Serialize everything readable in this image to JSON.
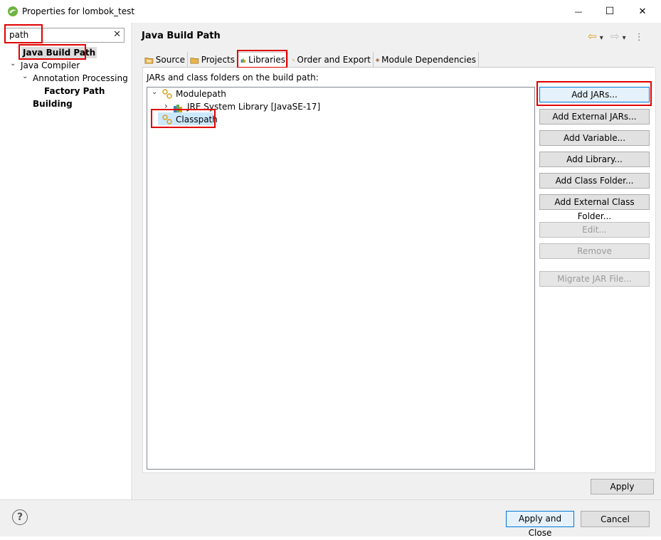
{
  "window": {
    "title": "Properties for lombok_test",
    "minimize_glyph": "—",
    "maximize_glyph": "☐",
    "close_glyph": "✕"
  },
  "filter": {
    "value": "path",
    "clear_glyph": "✕"
  },
  "nav_tree": {
    "items": [
      {
        "label": "Java Build Path",
        "arrow": ""
      },
      {
        "label": "Java Compiler",
        "arrow": "⌄"
      },
      {
        "label": "Annotation Processing",
        "arrow": "⌄"
      },
      {
        "label": "Factory Path",
        "arrow": ""
      },
      {
        "label": "Building",
        "arrow": ""
      }
    ]
  },
  "page": {
    "title": "Java Build Path",
    "back_glyph": "⇦",
    "dropdown_glyph": "▾",
    "forward_glyph": "⇨",
    "menu_glyph": "⋮"
  },
  "tabs": [
    {
      "label": "Source",
      "icon": "source-folder-icon"
    },
    {
      "label": "Projects",
      "icon": "projects-icon"
    },
    {
      "label": "Libraries",
      "icon": "libraries-icon"
    },
    {
      "label": "Order and Export",
      "icon": "order-export-icon"
    },
    {
      "label": "Module Dependencies",
      "icon": "module-dependencies-icon"
    }
  ],
  "libraries": {
    "section_label": "JARs and class folders on the build path:",
    "tree": [
      {
        "label": "Modulepath",
        "arrow": "⌄"
      },
      {
        "label": "JRE System Library [JavaSE-17]",
        "arrow": "›"
      },
      {
        "label": "Classpath",
        "arrow": ""
      }
    ],
    "buttons": [
      {
        "label": "Add JARs...",
        "enabled": true
      },
      {
        "label": "Add External JARs...",
        "enabled": true
      },
      {
        "label": "Add Variable...",
        "enabled": true
      },
      {
        "label": "Add Library...",
        "enabled": true
      },
      {
        "label": "Add Class Folder...",
        "enabled": true
      },
      {
        "label": "Add External Class Folder...",
        "enabled": true
      },
      {
        "label": "Edit...",
        "enabled": false
      },
      {
        "label": "Remove",
        "enabled": false
      },
      {
        "label": "Migrate JAR File...",
        "enabled": false
      }
    ]
  },
  "footer": {
    "apply": "Apply",
    "apply_and_close": "Apply and Close",
    "cancel": "Cancel",
    "help_glyph": "?"
  },
  "colors": {
    "highlight_box": "#e00000",
    "accent": "#0078d7",
    "selection": "#cce8ff"
  }
}
